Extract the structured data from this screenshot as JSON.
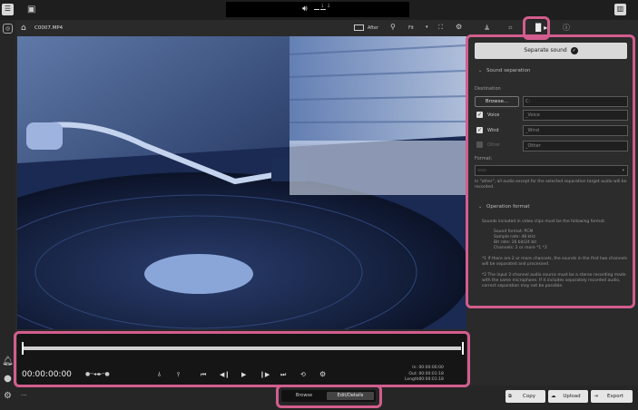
{
  "toolbar": {
    "title": "C0007.MP4",
    "after_label": "After",
    "fit_label": "Fit"
  },
  "vu": {
    "ch1": "1",
    "ch2": "2"
  },
  "right_panel": {
    "separate_button": "Separate sound",
    "sound_separation_header": "Sound separation",
    "destination_label": "Destination",
    "browse_button": "Browse...",
    "destination_value": "C:",
    "voice_label": "Voice",
    "voice_value": "_Voice",
    "wind_label": "Wind",
    "wind_value": "_Wind",
    "other_label": "Other",
    "other_value": "_Other",
    "format_label": "Format:",
    "format_value": "wav",
    "other_note": "In \"other\", all audio except for the selected separation target audio will be recorded.",
    "operation_header": "Operation format",
    "op_intro": "Sounds included in video clips must be the following format.",
    "sound_format": "Sound format:  PCM",
    "sample_rate": "Sample rate: 48 kHz",
    "bit_rate": "Bit rate: 16 bit/24 bit",
    "channels": "Channels: 2 or more *1 *2",
    "note1": "*1  If there are 2 or more channels, the sounds in the first two channels will be separated and processed.",
    "note2": "*2  The input 2-channel audio source must be a stereo recording made with the same microphone. If it includes separately recorded audio, correct separation may not be possible."
  },
  "player": {
    "timecode": "00:00:00:00",
    "in_label": "In:",
    "in_value": "00:00:00:00",
    "out_label": "Out:",
    "out_value": "00:00:01:18",
    "length_label": "Length:",
    "length_value": "00:00:01:18"
  },
  "bottom": {
    "browse_tab": "Browse",
    "edit_tab": "Edit/Details",
    "copy_button": "Copy",
    "upload_button": "Upload",
    "export_button": "Export",
    "more_label": "···"
  },
  "colors": {
    "highlight": "#d35d8e",
    "accent_check": "#1e1e1e"
  }
}
